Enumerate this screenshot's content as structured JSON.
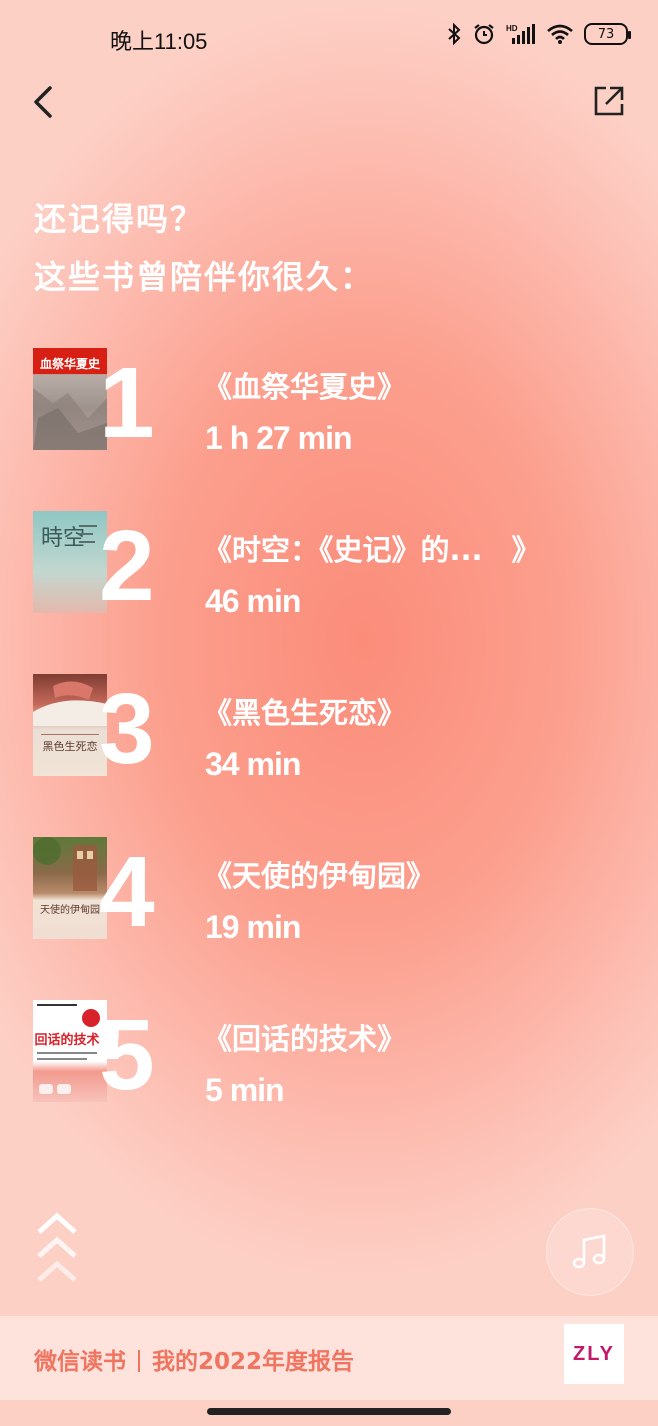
{
  "status_bar": {
    "time": "晚上11:05",
    "battery": "73",
    "icons": [
      "bluetooth-icon",
      "alarm-icon",
      "cellular-signal-icon",
      "wifi-icon",
      "battery-icon"
    ]
  },
  "nav": {
    "back_icon": "chevron-left-icon",
    "share_icon": "share-external-icon"
  },
  "headline": {
    "line1": "还记得吗？",
    "line2": "这些书曾陪伴你很久："
  },
  "books": [
    {
      "rank": "1",
      "title": "《血祭华夏史》",
      "duration": "1 h 27 min",
      "cover_text": "血祭华夏史"
    },
    {
      "rank": "2",
      "title": "《时空：《史记》的...　》",
      "duration": "46 min",
      "cover_text": "時空"
    },
    {
      "rank": "3",
      "title": "《黑色生死恋》",
      "duration": "34 min",
      "cover_text": "黑色生死恋"
    },
    {
      "rank": "4",
      "title": "《天使的伊甸园》",
      "duration": "19 min",
      "cover_text": "天使的伊甸园"
    },
    {
      "rank": "5",
      "title": "《回话的技术》",
      "duration": "5 min",
      "cover_text": "回话的技术"
    }
  ],
  "controls": {
    "scroll_icon": "triple-chevron-up-icon",
    "music_icon": "music-note-icon"
  },
  "footer": {
    "app_name": "微信读书",
    "report_title": "我的2022年度报告",
    "logo_text": "ZLY"
  },
  "colors": {
    "background_center": "#fb8c7a",
    "background_edge": "#fdd0c6",
    "footer_bg": "#fde3dc",
    "footer_text": "#f07561"
  }
}
